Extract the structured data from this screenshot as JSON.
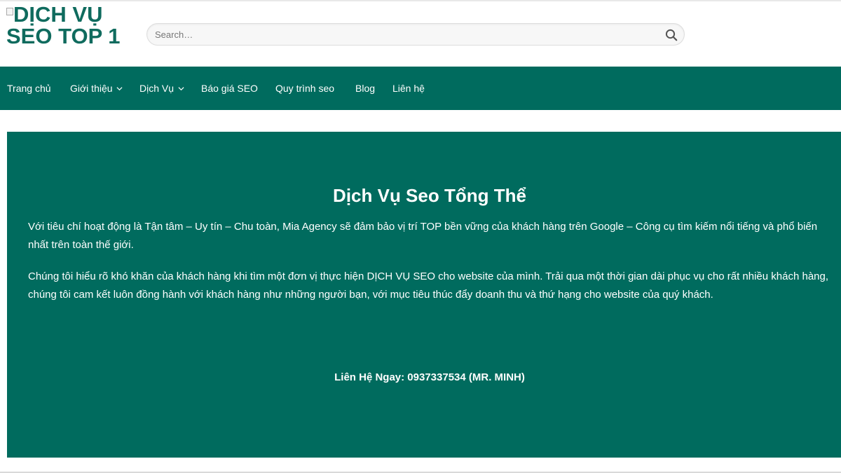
{
  "header": {
    "logo_alt": "DỊCH VỤ SEO TOP 1",
    "search": {
      "placeholder": "Search…",
      "value": "",
      "icon": "search-icon"
    }
  },
  "nav": {
    "items": [
      {
        "label": "Trang chủ",
        "has_dropdown": false
      },
      {
        "label": "Giới thiệu",
        "has_dropdown": true
      },
      {
        "label": "Dịch Vụ",
        "has_dropdown": true
      },
      {
        "label": "Báo giá SEO",
        "has_dropdown": false
      },
      {
        "label": "Quy trình seo",
        "has_dropdown": false
      },
      {
        "label": "Blog",
        "has_dropdown": false
      },
      {
        "label": "Liên hệ",
        "has_dropdown": false
      }
    ]
  },
  "banner": {
    "title": "Dịch Vụ Seo Tổng Thể",
    "paragraphs": [
      "Với tiêu chí hoạt động là Tận tâm – Uy tín – Chu toàn, Mia Agency sẽ đảm bảo vị trí TOP bền vững của khách hàng trên Google – Công cụ tìm kiếm nổi tiếng và phổ biến nhất trên toàn thế giới.",
      "Chúng tôi hiểu rõ khó khăn của khách hàng khi tìm một đơn vị thực hiện DỊCH VỤ SEO cho website của mình. Trải qua một thời gian dài phục vụ cho rất nhiều khách hàng, chúng tôi cam kết luôn đồng hành với khách hàng như những người bạn, với mục tiêu thúc đẩy doanh thu và thứ hạng cho website của quý khách."
    ],
    "contact": "Liên Hệ Ngay: 0937337534 (MR. MINH)"
  },
  "colors": {
    "brand": "#006b5e",
    "logo_text": "#0f6b5e",
    "nav_text": "#ffffff"
  }
}
